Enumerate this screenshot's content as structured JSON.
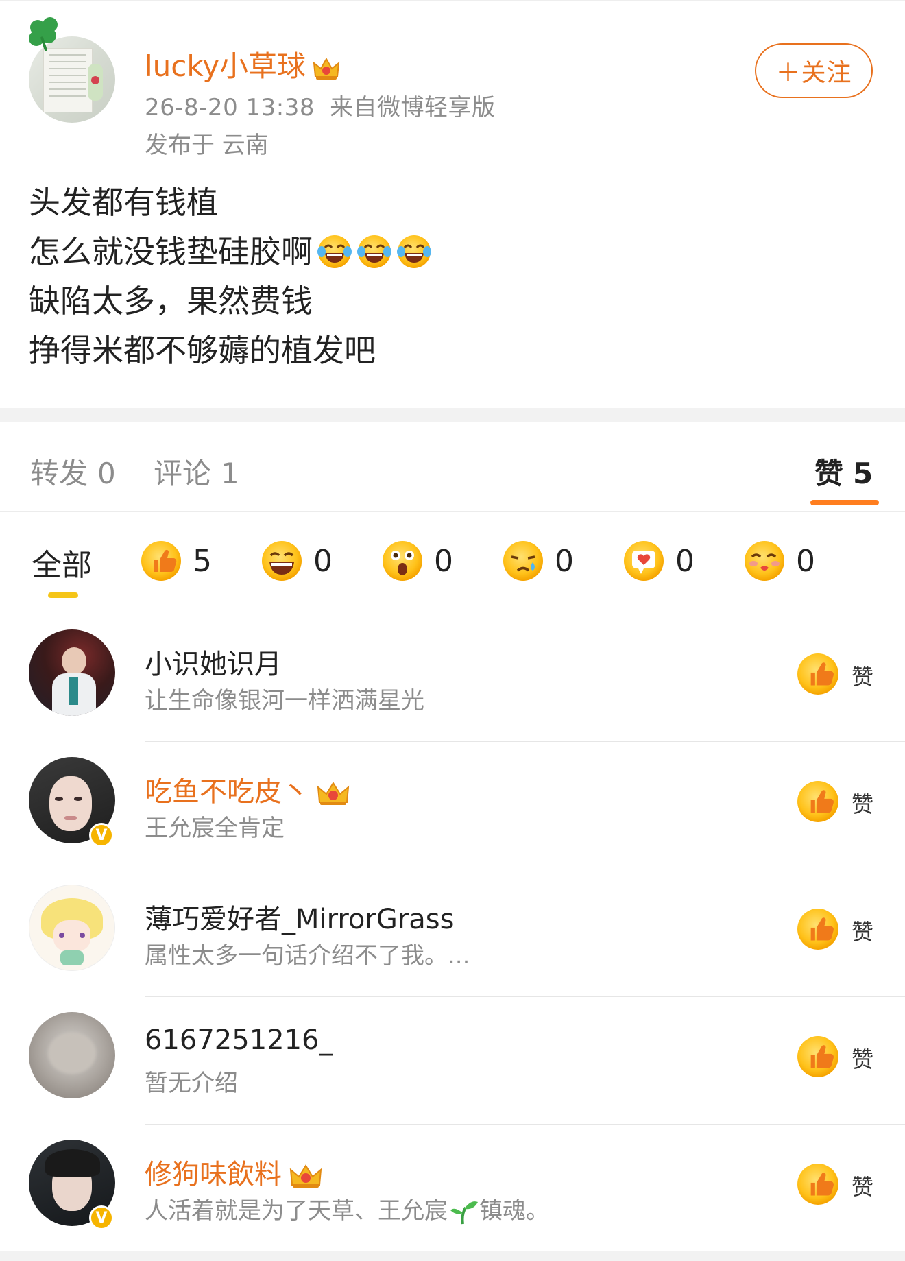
{
  "post": {
    "username": "lucky小草球",
    "timestamp": "26-8-20 13:38",
    "source": "来自微博轻享版",
    "location": "发布于 云南",
    "follow_label": "＋关注",
    "lines": [
      "头发都有钱植",
      "怎么就没钱垫硅胶啊",
      "缺陷太多，果然费钱",
      "挣得米都不够薅的植发吧"
    ],
    "line2_emoji": "laughing-tears-icon"
  },
  "tabs": {
    "repost_label": "转发",
    "repost_count": "0",
    "comment_label": "评论",
    "comment_count": "1",
    "like_label": "赞",
    "like_count": "5"
  },
  "reactions": {
    "all_label": "全部",
    "items": [
      {
        "icon": "thumbs-up-icon",
        "count": "5"
      },
      {
        "icon": "grin-icon",
        "count": "0"
      },
      {
        "icon": "surprised-icon",
        "count": "0"
      },
      {
        "icon": "crying-icon",
        "count": "0"
      },
      {
        "icon": "heart-icon",
        "count": "0"
      },
      {
        "icon": "kiss-icon",
        "count": "0"
      }
    ]
  },
  "likers": [
    {
      "name": "小识她识月",
      "bio": "让生命像银河一样洒满星光",
      "vip": false,
      "verified": false,
      "like_label": "赞"
    },
    {
      "name": "吃鱼不吃皮丶",
      "bio": "王允宸全肯定",
      "vip": true,
      "verified": true,
      "like_label": "赞"
    },
    {
      "name": "薄巧爱好者_MirrorGrass",
      "bio": "属性太多一句话介绍不了我。...",
      "vip": false,
      "verified": false,
      "like_label": "赞"
    },
    {
      "name": "6167251216_",
      "bio": "暂无介绍",
      "vip": false,
      "verified": false,
      "like_label": "赞"
    },
    {
      "name": "修狗味飲料",
      "bio": "人活着就是为了天草、王允宸",
      "bio_suffix": "镇魂。",
      "vip": true,
      "verified": true,
      "like_label": "赞"
    }
  ],
  "verified_badge": "V",
  "colors": {
    "accent": "#e8711e",
    "tab_indicator": "#ff7e1f",
    "emoji_yellow": "#f6b400"
  }
}
